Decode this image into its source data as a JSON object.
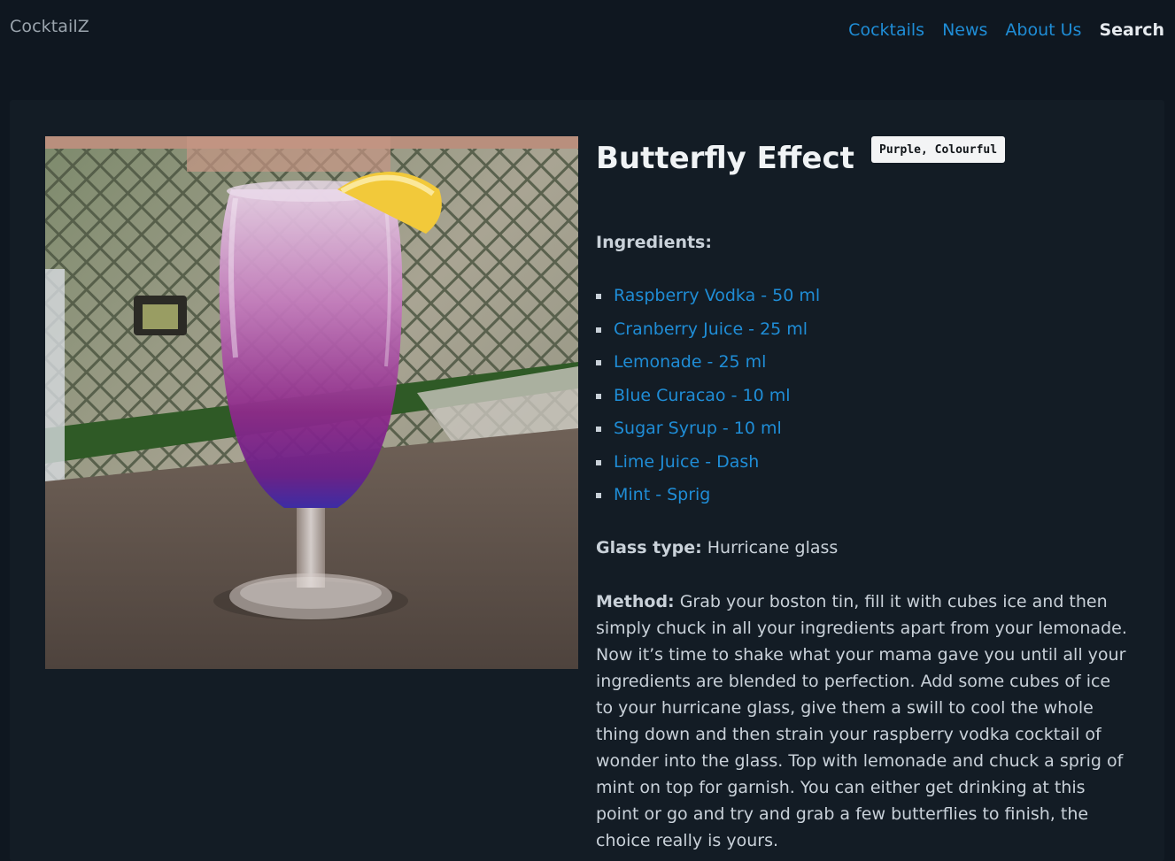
{
  "header": {
    "brand": "CocktailZ",
    "nav": [
      "Cocktails",
      "News",
      "About Us",
      "Search"
    ],
    "active_nav": "Search"
  },
  "cocktail": {
    "title": "Butterfly Effect",
    "tags": "Purple, Colourful",
    "ingredients_label": "Ingredients:",
    "ingredients": [
      "Raspberry Vodka - 50 ml",
      "Cranberry Juice - 25 ml",
      "Lemonade - 25 ml",
      "Blue Curacao - 10 ml",
      "Sugar Syrup - 10 ml",
      "Lime Juice - Dash",
      "Mint - Sprig"
    ],
    "glass_label": "Glass type:",
    "glass_value": "Hurricane glass",
    "method_label": "Method:",
    "method_text": "Grab your boston tin, fill it with cubes ice and then simply chuck in all your ingredients apart from your lemonade. Now it’s time to shake what your mama gave you until all your ingredients are blended to perfection. Add some cubes of ice to your hurricane glass, give them a swill to cool the whole thing down and then strain your raspberry vodka cocktail of wonder into the glass. Top with lemonade and chuck a sprig of mint on top for garnish. You can either get drinking at this point or go and try and grab a few butterflies to finish, the choice really is yours."
  },
  "colors": {
    "page_bg": "#0f1720",
    "card_bg": "#131c25",
    "link": "#1f8dd6",
    "text": "#c9d1d9",
    "heading": "#f0f3f5"
  }
}
